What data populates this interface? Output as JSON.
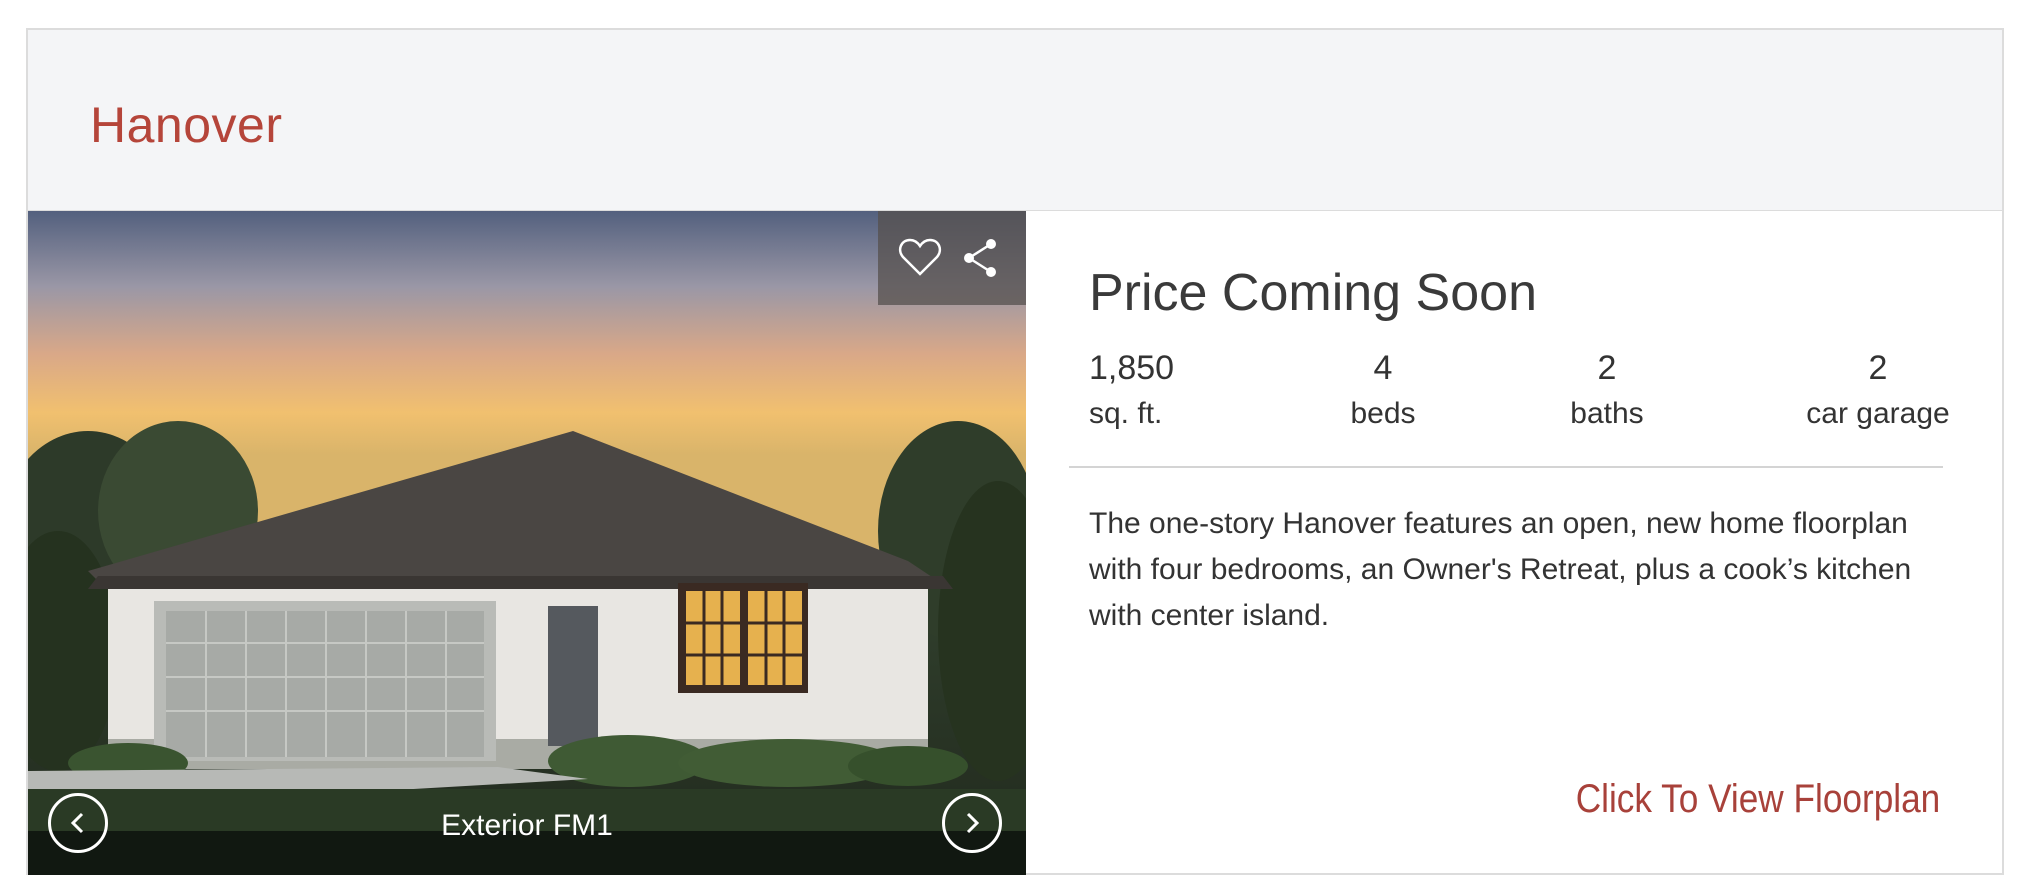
{
  "plan": {
    "title": "Hanover"
  },
  "gallery": {
    "caption": "Exterior FM1",
    "icons": {
      "favorite": "heart-icon",
      "share": "share-icon",
      "previous": "chevron-left-icon",
      "next": "chevron-right-icon"
    }
  },
  "details": {
    "price": "Price Coming Soon",
    "stats": [
      {
        "value": "1,850",
        "label": "sq. ft."
      },
      {
        "value": "4",
        "label": "beds"
      },
      {
        "value": "2",
        "label": "baths"
      },
      {
        "value": "2",
        "label": "car garage"
      }
    ],
    "description": "The one-story Hanover features an open, new home floorplan with four bedrooms, an Owner's Retreat, plus a cook’s kitchen with center island.",
    "floorplan_link": "Click To View Floorplan"
  },
  "colors": {
    "accent": "#b5453a",
    "link": "#a8413a",
    "header_bg": "#f4f5f7"
  }
}
